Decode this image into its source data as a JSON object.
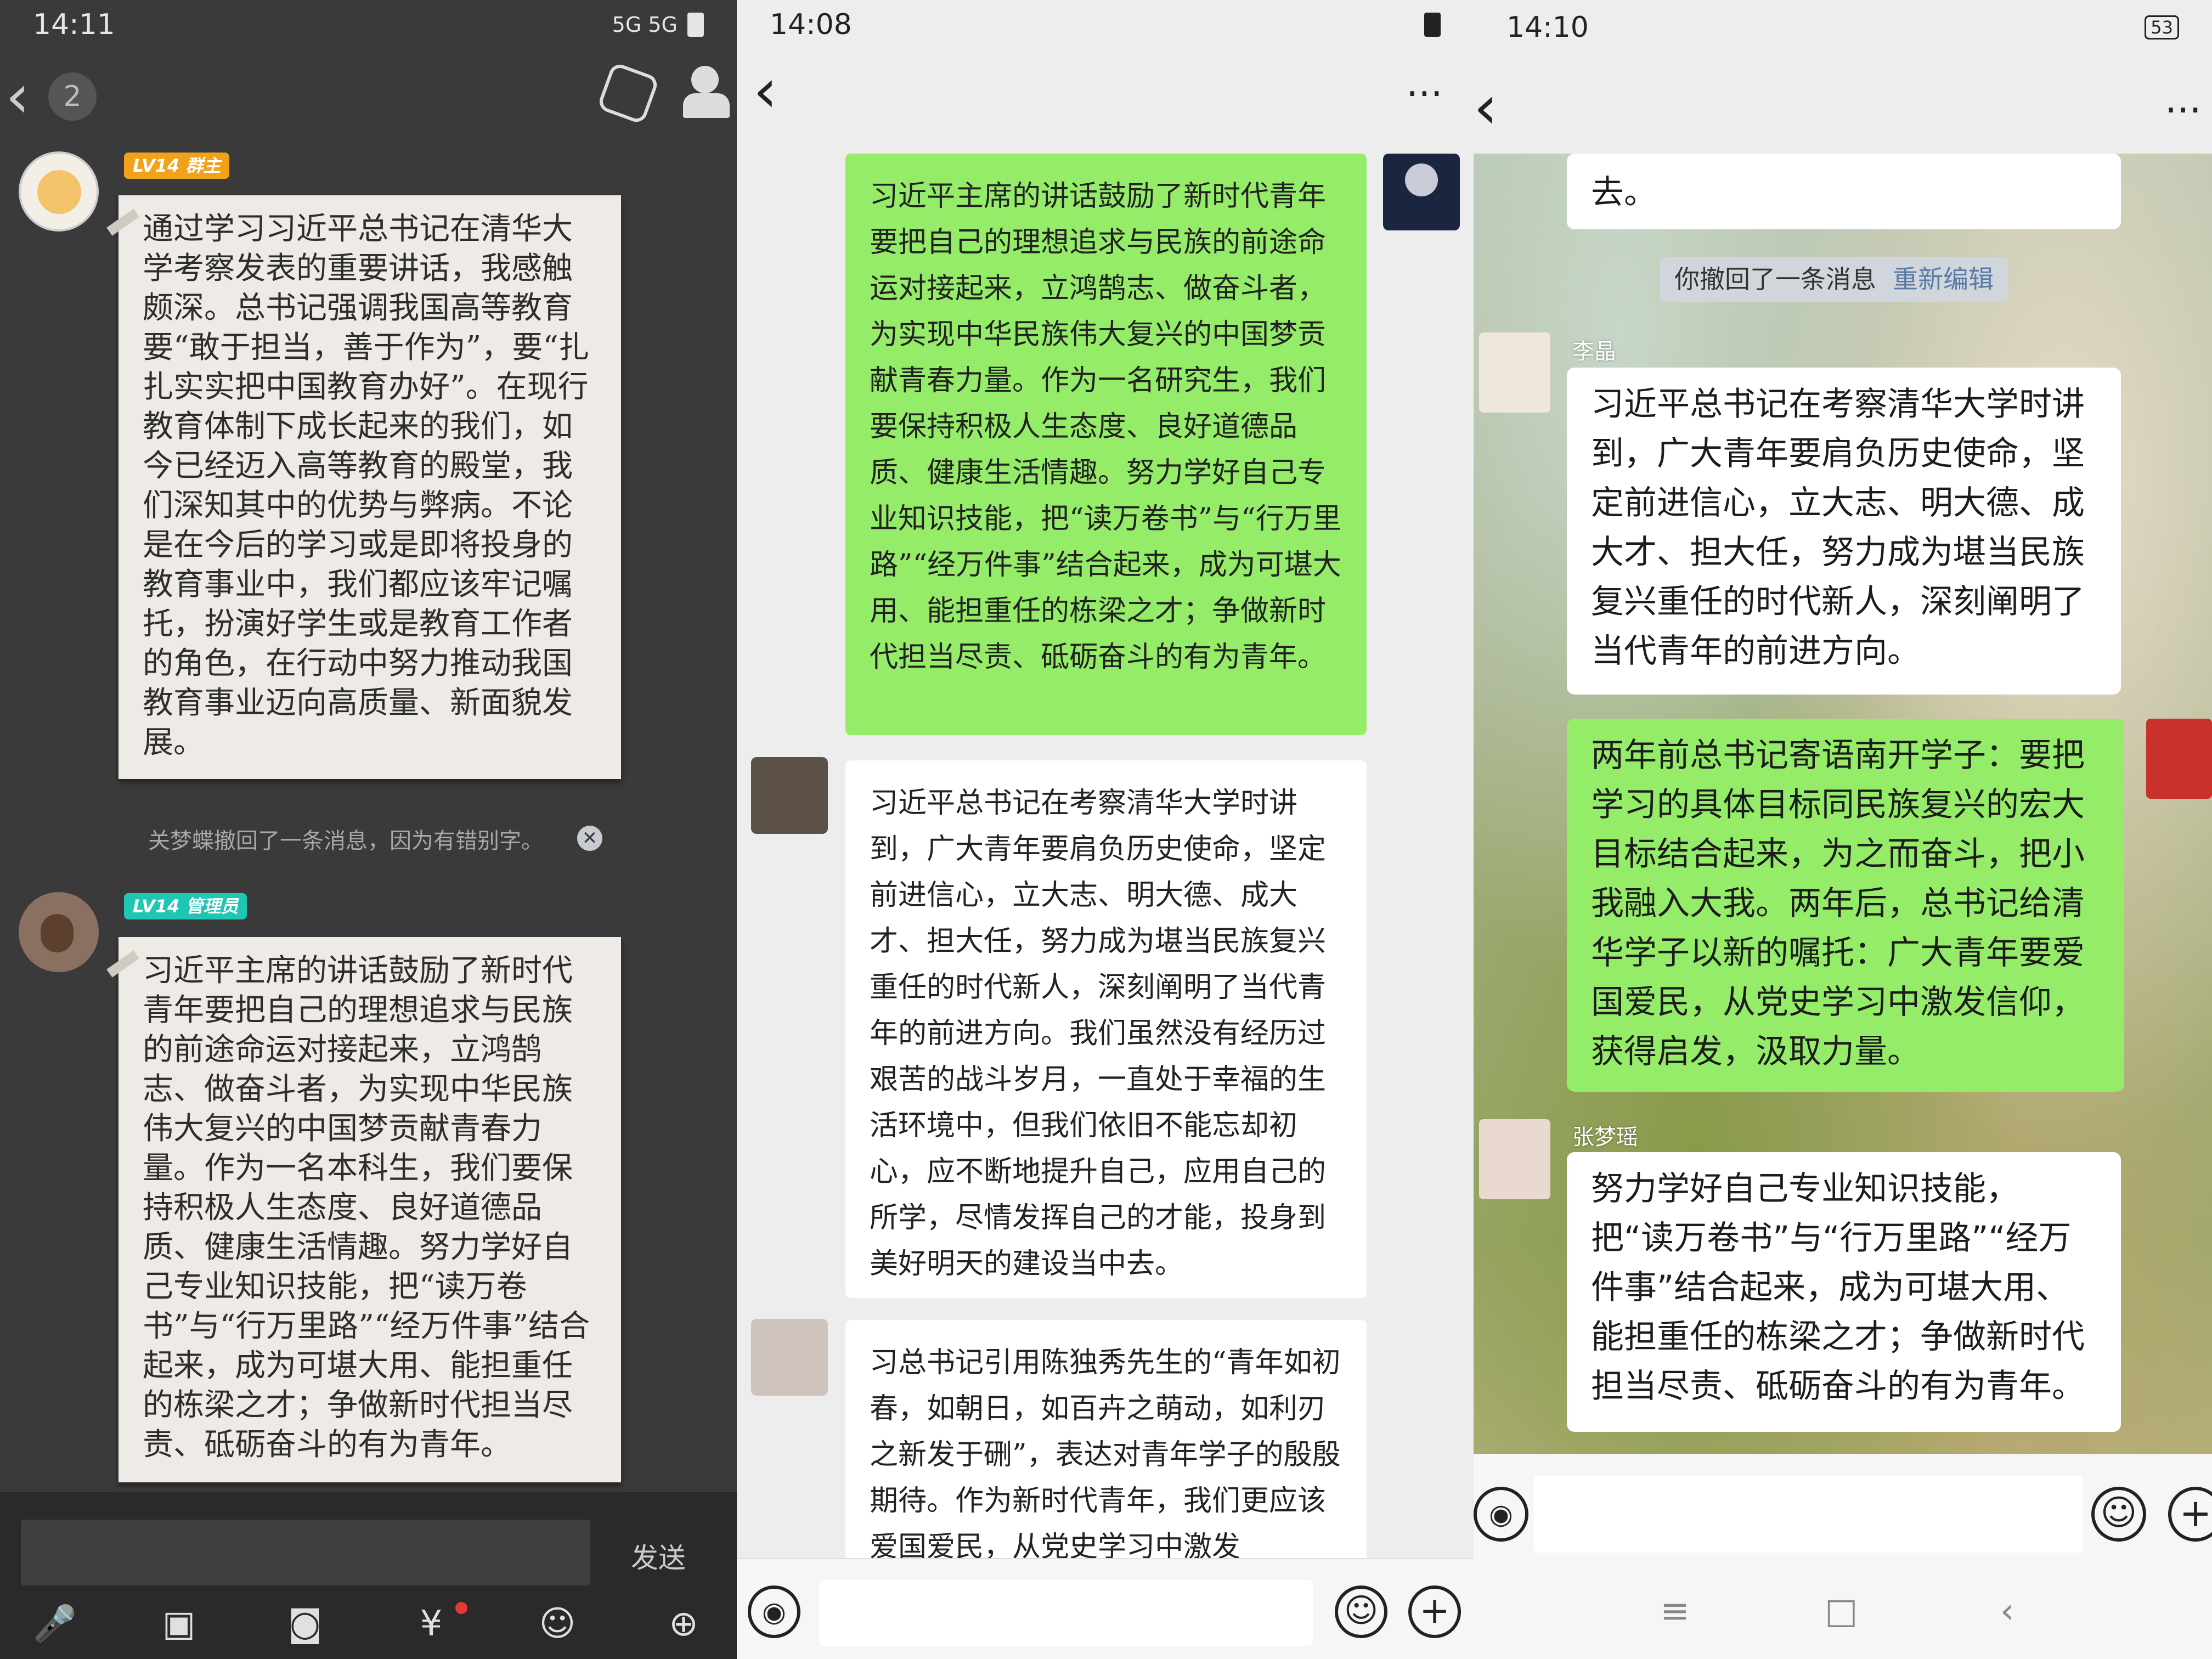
{
  "panel1": {
    "status_time": "14:11",
    "status_icons": "5G 5G",
    "back_label": "‹",
    "unread_count": "2",
    "msg1": {
      "tag": "LV14 群主",
      "tag_color": "#f0a21a",
      "text": "通过学习习近平总书记在清华大学考察发表的重要讲话，我感触颇深。总书记强调我国高等教育要“敢于担当，善于作为”，要“扎扎实实把中国教育办好”。在现行教育体制下成长起来的我们，如今已经迈入高等教育的殿堂，我们深知其中的优势与弊病。不论是在今后的学习或是即将投身的教育事业中，我们都应该牢记嘱托，扮演好学生或是教育工作者的角色，在行动中努力推动我国教育事业迈向高质量、新面貌发展。"
    },
    "recall_notice": "关梦蝶撤回了一条消息，因为有错别字。",
    "msg2": {
      "tag": "LV14 管理员",
      "tag_color": "#1fc6b4",
      "text": "习近平主席的讲话鼓励了新时代青年要把自己的理想追求与民族的前途命运对接起来，立鸿鹄志、做奋斗者，为实现中华民族伟大复兴的中国梦贡献青春力量。作为一名本科生，我们要保持积极人生态度、良好道德品质、健康生活情趣。努力学好自己专业知识技能，把“读万卷书”与“行万里路”“经万件事”结合起来，成为可堪大用、能担重任的栋梁之才；争做新时代担当尽责、砥砺奋斗的有为青年。"
    },
    "send_label": "发送"
  },
  "panel2": {
    "status_time": "14:08",
    "more_label": "···",
    "msg1": "习近平主席的讲话鼓励了新时代青年要把自己的理想追求与民族的前途命运对接起来，立鸿鹄志、做奋斗者，为实现中华民族伟大复兴的中国梦贡献青春力量。作为一名研究生，我们要保持积极人生态度、良好道德品质、健康生活情趣。努力学好自己专业知识技能，把“读万卷书”与“行万里路”“经万件事”结合起来，成为可堪大用、能担重任的栋梁之才；争做新时代担当尽责、砥砺奋斗的有为青年。",
    "msg2": "习近平总书记在考察清华大学时讲到，广大青年要肩负历史使命，坚定前进信心，立大志、明大德、成大才、担大任，努力成为堪当民族复兴重任的时代新人，深刻阐明了当代青年的前进方向。我们虽然没有经历过艰苦的战斗岁月，一直处于幸福的生活环境中，但我们依旧不能忘却初心，应不断地提升自己，应用自己的所学，尽情发挥自己的才能，投身到美好明天的建设当中去。",
    "msg3": "习总书记引用陈独秀先生的“青年如初春，如朝日，如百卉之萌动，如利刃之新发于硎”，表达对青年学子的殷殷期待。作为新时代青年，我们更应该爱国爱民，从党史学习中激发"
  },
  "panel3": {
    "status_time": "14:10",
    "battery": "53",
    "partial_msg_tail": "去。",
    "recall_text": "你撤回了一条消息",
    "reedit_label": "重新编辑",
    "nick1": "李晶",
    "msg1": "习近平总书记在考察清华大学时讲到，广大青年要肩负历史使命，坚定前进信心，立大志、明大德、成大才、担大任，努力成为堪当民族复兴重任的时代新人，深刻阐明了当代青年的前进方向。",
    "msg2": "两年前总书记寄语南开学子：要把学习的具体目标同民族复兴的宏大目标结合起来，为之而奋斗，把小我融入大我。两年后，总书记给清华学子以新的嘱托：广大青年要爱国爱民，从党史学习中激发信仰，获得启发，汲取力量。",
    "nick2": "张梦瑶",
    "msg3": "努力学好自己专业知识技能，把“读万卷书”与“行万里路”“经万件事”结合起来，成为可堪大用、能担重任的栋梁之才；争做新时代担当尽责、砥砺奋斗的有为青年。"
  },
  "icons": {
    "back": "‹",
    "more": "···",
    "voice": "◉",
    "emoji": "☺",
    "plus": "+",
    "mic": "🎤",
    "image": "▣",
    "camera": "◙",
    "redpacket": "¥",
    "menu": "≡",
    "home": "□",
    "navback": "‹"
  }
}
